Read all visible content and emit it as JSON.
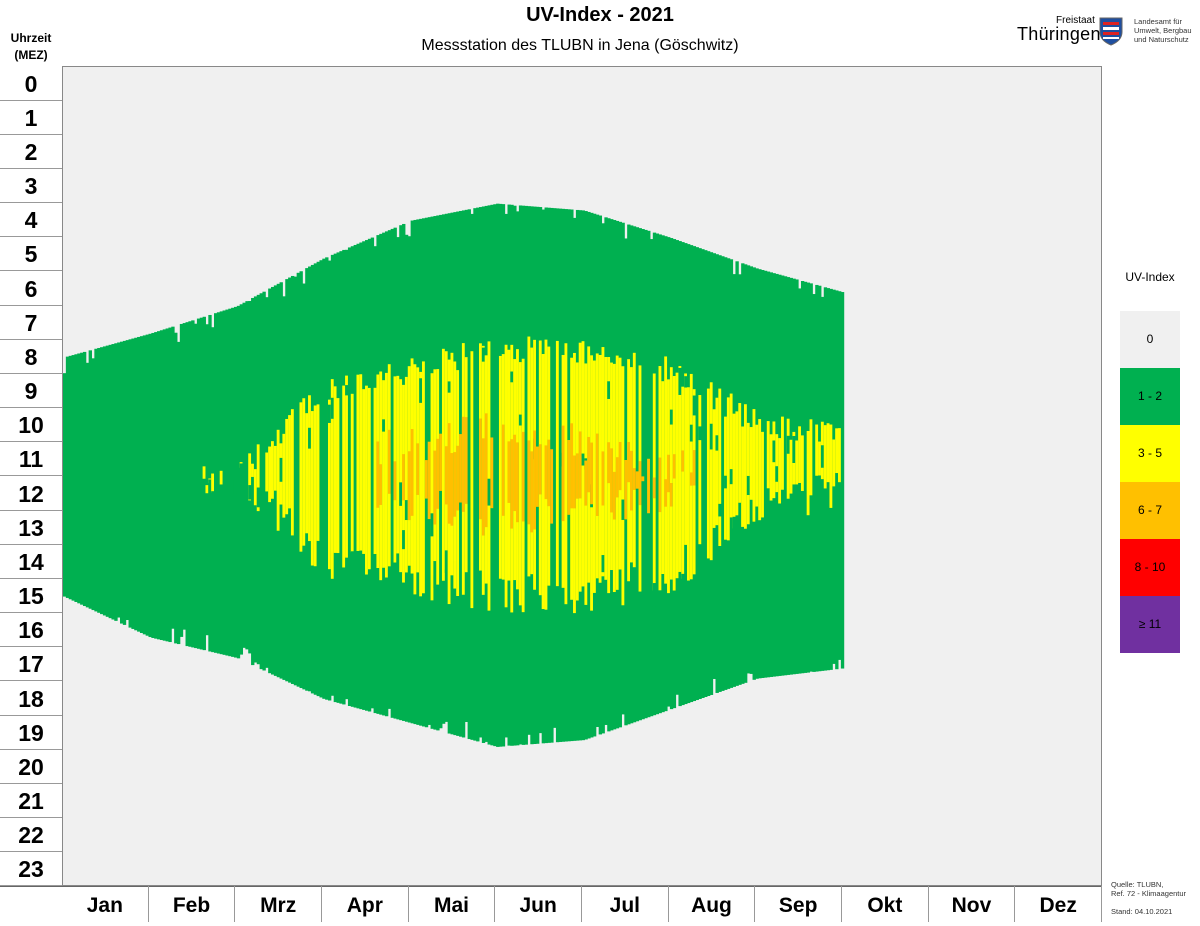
{
  "header": {
    "title": "UV-Index - 2021",
    "subtitle": "Messstation des TLUBN in Jena (Göschwitz)",
    "y_header": [
      "Uhrzeit",
      "(MEZ)"
    ]
  },
  "logo": {
    "freistaat": "Freistaat",
    "land": "Thüringen",
    "org_lines": [
      "Landesamt für",
      "Umwelt, Bergbau",
      "und Naturschutz"
    ]
  },
  "legend": {
    "title": "UV-Index",
    "items": [
      {
        "label": "0",
        "color": "#f0f0f0"
      },
      {
        "label": "1 - 2",
        "color": "#00b050"
      },
      {
        "label": "3 - 5",
        "color": "#ffff00"
      },
      {
        "label": "6 - 7",
        "color": "#ffc000"
      },
      {
        "label": "8 - 10",
        "color": "#ff0000"
      },
      {
        "label": "≥ 11",
        "color": "#7030a0"
      }
    ]
  },
  "footer": {
    "source_lines": [
      "Quelle: TLUBN,",
      "Ref. 72 - Klimaagentur"
    ],
    "stand": "Stand: 04.10.2021"
  },
  "chart_data": {
    "type": "heatmap",
    "title": "UV-Index - 2021",
    "subtitle": "Messstation des TLUBN in Jena (Göschwitz)",
    "ylabel": "Uhrzeit (MEZ)",
    "y_categories": [
      "0",
      "1",
      "2",
      "3",
      "4",
      "5",
      "6",
      "7",
      "8",
      "9",
      "10",
      "11",
      "12",
      "13",
      "14",
      "15",
      "16",
      "17",
      "18",
      "19",
      "20",
      "21",
      "22",
      "23"
    ],
    "x_categories": [
      "Jan",
      "Feb",
      "Mrz",
      "Apr",
      "Mai",
      "Jun",
      "Jul",
      "Aug",
      "Sep",
      "Okt",
      "Nov",
      "Dez"
    ],
    "data_end_month_fraction": 9.0,
    "class_colors": {
      "0": "#f0f0f0",
      "1-2": "#00b050",
      "3-5": "#ffff00",
      "6-7": "#ffc000",
      "8-10": "#ff0000",
      ">=11": "#7030a0"
    },
    "regions_by_month_start": [
      {
        "month": "Jan",
        "uv_gt0_from_hour": 8.5,
        "uv_gt0_to_hour": 15.5,
        "uv_3_5_from_hour": null,
        "uv_3_5_to_hour": null,
        "uv_6_7_from_hour": null,
        "uv_6_7_to_hour": null
      },
      {
        "month": "Feb",
        "uv_gt0_from_hour": 7.8,
        "uv_gt0_to_hour": 16.7,
        "uv_3_5_from_hour": null,
        "uv_3_5_to_hour": null,
        "uv_6_7_from_hour": null,
        "uv_6_7_to_hour": null
      },
      {
        "month": "Mrz",
        "uv_gt0_from_hour": 7.0,
        "uv_gt0_to_hour": 17.3,
        "uv_3_5_from_hour": 11.5,
        "uv_3_5_to_hour": 12.5,
        "uv_6_7_from_hour": null,
        "uv_6_7_to_hour": null
      },
      {
        "month": "Apr",
        "uv_gt0_from_hour": 5.6,
        "uv_gt0_to_hour": 18.5,
        "uv_3_5_from_hour": 9.0,
        "uv_3_5_to_hour": 15.0,
        "uv_6_7_from_hour": null,
        "uv_6_7_to_hour": null
      },
      {
        "month": "Mai",
        "uv_gt0_from_hour": 4.5,
        "uv_gt0_to_hour": 19.2,
        "uv_3_5_from_hour": 8.5,
        "uv_3_5_to_hour": 15.5,
        "uv_6_7_from_hour": 10.5,
        "uv_6_7_to_hour": 13.5
      },
      {
        "month": "Jun",
        "uv_gt0_from_hour": 4.0,
        "uv_gt0_to_hour": 19.9,
        "uv_3_5_from_hour": 7.8,
        "uv_3_5_to_hour": 16.0,
        "uv_6_7_from_hour": 10.0,
        "uv_6_7_to_hour": 13.8
      },
      {
        "month": "Jul",
        "uv_gt0_from_hour": 4.2,
        "uv_gt0_to_hour": 19.7,
        "uv_3_5_from_hour": 8.0,
        "uv_3_5_to_hour": 16.0,
        "uv_6_7_from_hour": 10.5,
        "uv_6_7_to_hour": 13.5
      },
      {
        "month": "Aug",
        "uv_gt0_from_hour": 5.0,
        "uv_gt0_to_hour": 18.8,
        "uv_3_5_from_hour": 8.5,
        "uv_3_5_to_hour": 15.5,
        "uv_6_7_from_hour": 11.0,
        "uv_6_7_to_hour": 13.0
      },
      {
        "month": "Sep",
        "uv_gt0_from_hour": 5.9,
        "uv_gt0_to_hour": 17.9,
        "uv_3_5_from_hour": 10.0,
        "uv_3_5_to_hour": 13.5,
        "uv_6_7_from_hour": null,
        "uv_6_7_to_hour": null
      },
      {
        "month": "Okt",
        "uv_gt0_from_hour": 6.6,
        "uv_gt0_to_hour": 17.6,
        "uv_3_5_from_hour": 10.5,
        "uv_3_5_to_hour": 13.0,
        "uv_6_7_from_hour": null,
        "uv_6_7_to_hour": null
      }
    ]
  }
}
